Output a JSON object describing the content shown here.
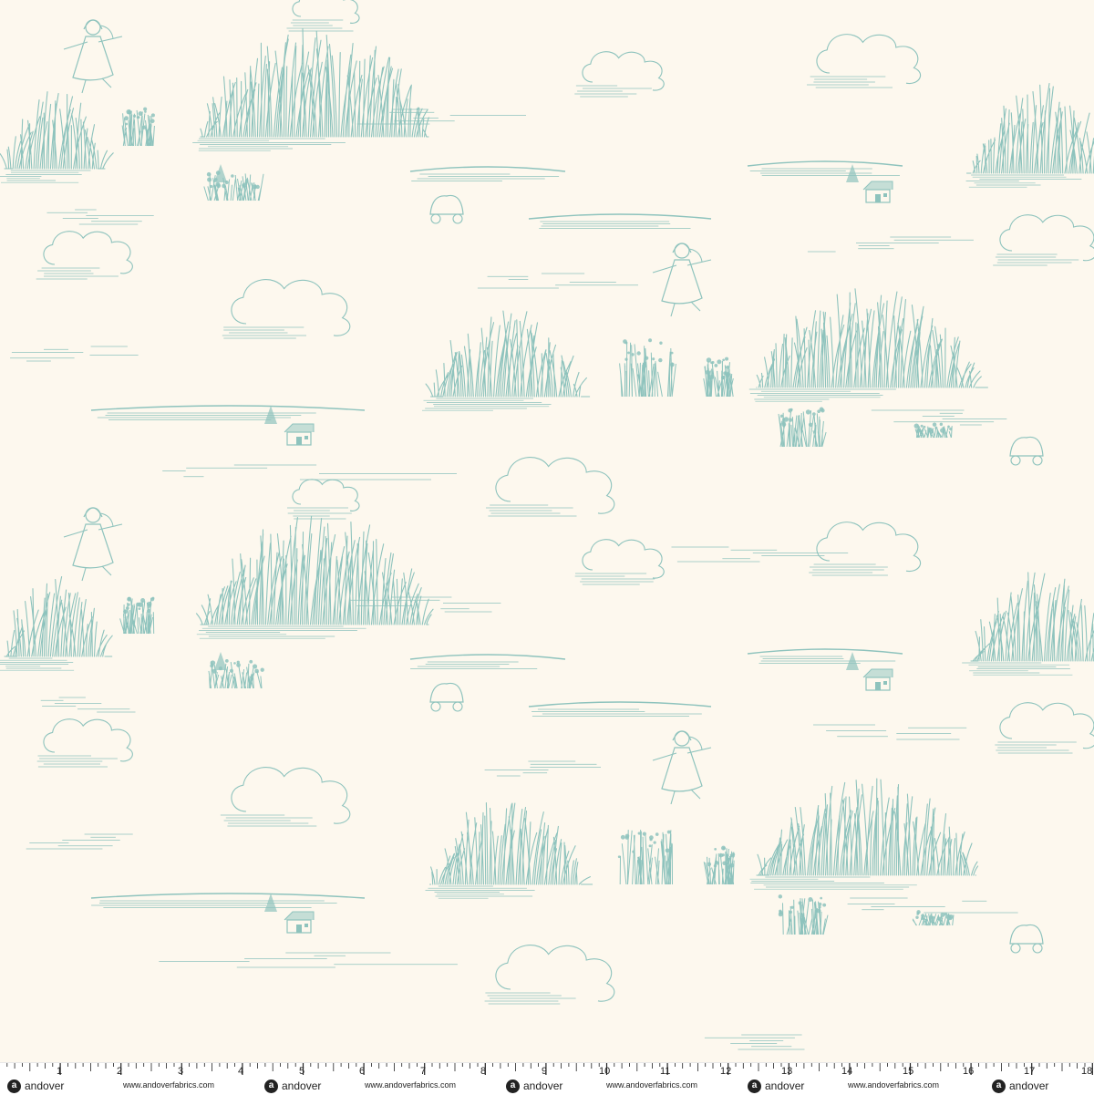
{
  "fabric": {
    "background_color": "#fdf8ee",
    "ink_color": "#8ec3bd",
    "motifs": [
      "girl-in-bonnet-icon",
      "prairie-grass-icon",
      "covered-wagon-icon",
      "log-cabin-icon",
      "cloud-icon",
      "shrub-icon",
      "pine-tree-icon"
    ]
  },
  "ruler": {
    "numbers": [
      "1",
      "2",
      "3",
      "4",
      "5",
      "6",
      "7",
      "8",
      "9",
      "10",
      "11",
      "12",
      "13",
      "14",
      "15",
      "16",
      "17",
      "18"
    ],
    "brand_name": "andover",
    "brand_logo_letter": "a",
    "website": "www.andoverfabrics.com"
  }
}
